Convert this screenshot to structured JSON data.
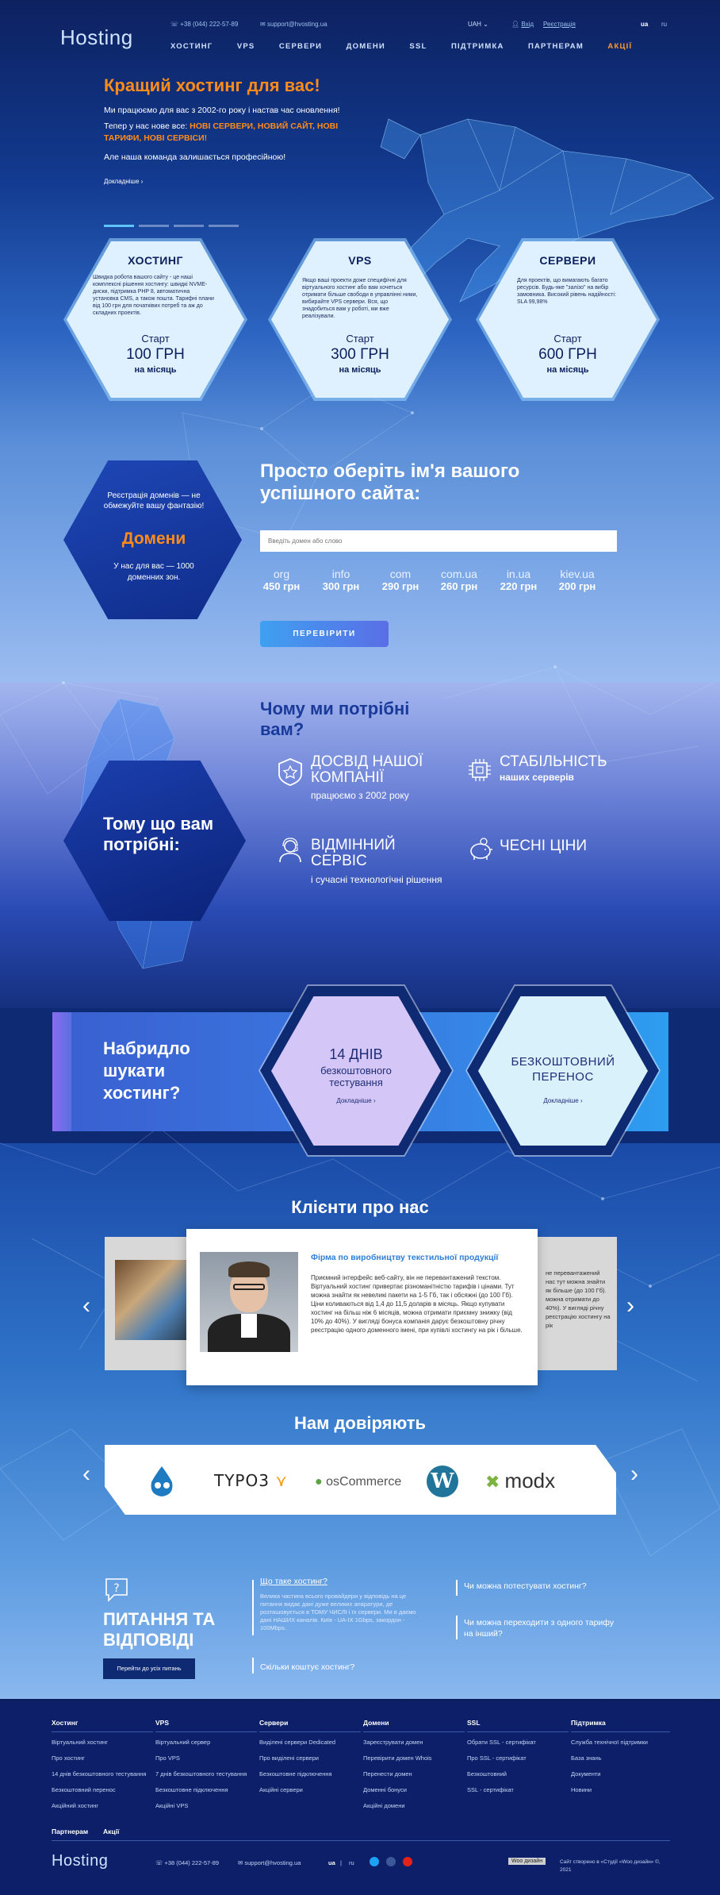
{
  "header": {
    "logo": "Hosting",
    "phone": "+38 (044) 222-57-89",
    "email": "support@hvosting.ua",
    "currency": "UAH",
    "login": "Вхід",
    "register": "Реєстрація",
    "lang_active": "ua",
    "lang_other": "ru",
    "nav": [
      "Хостинг",
      "VPS",
      "Сервери",
      "Домени",
      "SSL",
      "Підтримка",
      "Партнерам",
      "Акції"
    ]
  },
  "hero": {
    "title": "Кращий хостинг для вас!",
    "p1": "Ми працюємо для вас з 2002-го року і настав час оновлення!",
    "p2_prefix": "Тепер у нас нове все: ",
    "p2_highlight": "НОВІ СЕРВЕРИ, НОВИЙ САЙТ, НОВІ ТАРИФИ, НОВІ СЕРВІСИ!",
    "p3": "Але наша команда залишається професійною!",
    "more": "Докладніше"
  },
  "cards": [
    {
      "title": "ХОСТИНГ",
      "text": "Швидка робота вашого сайту - це наші комплексні рішення хостингу: швидкі NVME-диски, підтримка PHP 8, автоматична установка CMS, а також пошта. Тарифні плани від 100 грн для початківих потреб та аж до складних проектів.",
      "start": "Старт",
      "price": "100 ГРН",
      "unit": "на місяць"
    },
    {
      "title": "VPS",
      "text": "Якщо ваші проекти доже специфічні для віртуального хостинг або вам хочеться отримати більше свободи в управлінні ними, вибирайте VPS сервери. Вся, що знадобиться вам у роботі, ми вже реалізували.",
      "start": "Старт",
      "price": "300 ГРН",
      "unit": "на місяць"
    },
    {
      "title": "СЕРВЕРИ",
      "text": "Для проектів, що вимагають багато ресурсів. Будь-яке \"залізо\" на вибір замовника. Високий рівень надійності: SLA 99,98%",
      "start": "Старт",
      "price": "600 ГРН",
      "unit": "на місяць"
    }
  ],
  "domains": {
    "hex_line1": "Реєстрація доменів — не обмежуйте вашу фантазію!",
    "hex_title": "Домени",
    "hex_line2": "У нас для вас — 1000 доменних зон.",
    "title": "Просто оберіть ім'я вашого успішного сайта:",
    "placeholder": "Введіть домен або слово",
    "zones": [
      {
        "zone": "org",
        "price": "450 грн"
      },
      {
        "zone": "info",
        "price": "300 грн"
      },
      {
        "zone": "com",
        "price": "290 грн"
      },
      {
        "zone": "com.ua",
        "price": "260 грн"
      },
      {
        "zone": "in.ua",
        "price": "220 грн"
      },
      {
        "zone": "kiev.ua",
        "price": "200 грн"
      }
    ],
    "button": "ПЕРЕВІРИТИ"
  },
  "why": {
    "title": "Чому ми потрібні вам?",
    "hex_text": "Тому що вам потрібні:",
    "features": [
      {
        "h": "ДОСВІД НАШОЇ КОМПАНІЇ",
        "s": "працюємо з 2002 року",
        "icon": "badge-star-icon"
      },
      {
        "h": "СТАБІЛЬНІСТЬ",
        "s": "наших серверів",
        "icon": "chip-icon"
      },
      {
        "h": "ВІДМІННИЙ СЕРВІС",
        "s": "і сучасні технологічні рішення",
        "icon": "support-agent-icon"
      },
      {
        "h": "ЧЕСНІ ЦІНИ",
        "s": "",
        "icon": "piggy-bank-icon"
      }
    ]
  },
  "promo": {
    "question": "Набридло шукати хостинг?",
    "trial_num": "14 ДНІВ",
    "trial_text": "безкоштовного тестування",
    "trial_more": "Докладніше",
    "transfer": "БЕЗКОШТОВНИЙ ПЕРЕНОС",
    "transfer_more": "Докладніше"
  },
  "clients": {
    "title": "Клієнти про нас",
    "review_title": "Фірма по виробництву текстильної продукції",
    "review_text": "Приємний інтерфейс веб-сайту, він не перевантажений текстом. Віртуальний хостинг привертає різноманітністю тарифів і цінами. Тут можна знайти як невеликі пакети на 1-5 Гб, так і обсяжні (до 100 Гб). Ціни коливаються від 1,4 до 11,5 доларів в місяць. Якщо купувати хостинг на більш ніж 6 місяців, можна отримати приємну знижку (від 10% до 40%). У вигляді бонуса компанія дарує безкоштовну річну реєстрацію одного доменного імені, при купівлі хостингу на рік і більше.",
    "side_text": "не перевантажений нас тут можна знайти як більше (до 100 Гб). можна отримати до 40%). У вигляді річну реєстрацію хостингу на рік"
  },
  "trust": {
    "title": "Нам довіряють",
    "logos": [
      "drupal",
      "TYPO3",
      "osCommerce",
      "WordPress",
      "modx"
    ]
  },
  "faq": {
    "title": "ПИТАННЯ ТА ВІДПОВІДІ",
    "button": "Перейти до усіх питань",
    "q1": "Що таке хостинг?",
    "a1": "Велика частина всього провайдери у відповідь на це питання видає дані дуже великих апаратури, де розташовується в ТОМУ ЧИСЛІ і їх сервери. Ми в даємо дані НАШИХ каналів. Київ - UA-IX 1Gbps, закордон - 100Mbps.",
    "q2": "Скільки коштує хостинг?",
    "q3": "Чи можна потестувати хостинг?",
    "q4": "Чи можна переходити з одного тарифу на інший?"
  },
  "footer": {
    "cols": [
      {
        "h": "Хостинг",
        "items": [
          "Віртуальний хостинг",
          "Про хостинг",
          "14 днів безкоштовного тестування",
          "Безкоштовний перенос",
          "Акційний хостинг"
        ]
      },
      {
        "h": "VPS",
        "items": [
          "Віртуальний сервер",
          "Про VPS",
          "7 днів безкоштовного тестування",
          "Безкоштовне підключення",
          "Акційні VPS"
        ]
      },
      {
        "h": "Сервери",
        "items": [
          "Виділені сервери Dedicated",
          "Про виділені сервери",
          "Безкоштовне підключення",
          "Акційні сервери"
        ]
      },
      {
        "h": "Домени",
        "items": [
          "Зареєструвати домен",
          "Перевірити домен Whois",
          "Перенести домен",
          "Доменні бонуси",
          "Акційні домени"
        ]
      },
      {
        "h": "SSL",
        "items": [
          "Обрати SSL - сертифікат",
          "Про SSL - сертифікат",
          "Безкоштовний",
          "SSL - сертифікат"
        ]
      },
      {
        "h": "Підтримка",
        "items": [
          "Служба технічної підтримки",
          "База знань",
          "Документи",
          "Новини"
        ]
      }
    ],
    "partners": "Партнерам",
    "promo": "Акції",
    "logo": "Hosting",
    "phone": "+38 (044) 222-57-89",
    "email": "support@hvosting.ua",
    "lang_active": "ua",
    "lang_other": "ru",
    "badge": "Woo дизайн",
    "copyright": "Сайт створено в «Студії «Woo дизайн» ©, 2021"
  }
}
